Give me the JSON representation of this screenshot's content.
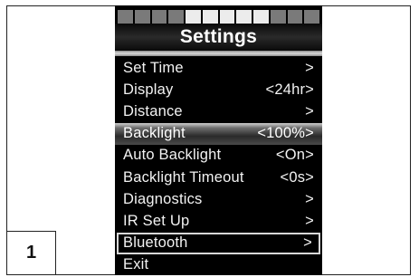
{
  "figure_number": "1",
  "screen": {
    "title": "Settings",
    "segment_colors": [
      "#7a7a7a",
      "#7a7a7a",
      "#7a7a7a",
      "#7a7a7a",
      "#ececec",
      "#ececec",
      "#ececec",
      "#ececec",
      "#ececec",
      "#7a7a7a",
      "#7a7a7a",
      "#7a7a7a"
    ],
    "menu": [
      {
        "label": "Set Time",
        "value": ">"
      },
      {
        "label": "Display",
        "value": "<24hr>"
      },
      {
        "label": "Distance",
        "value": ">"
      },
      {
        "label": "Backlight",
        "value": "<100%>"
      },
      {
        "label": "Auto Backlight",
        "value": "<On>"
      },
      {
        "label": "Backlight Timeout",
        "value": "<0s>"
      },
      {
        "label": "Diagnostics",
        "value": ">"
      },
      {
        "label": "IR Set Up",
        "value": ">"
      },
      {
        "label": "Bluetooth",
        "value": ">"
      },
      {
        "label": "Exit",
        "value": ""
      }
    ]
  }
}
